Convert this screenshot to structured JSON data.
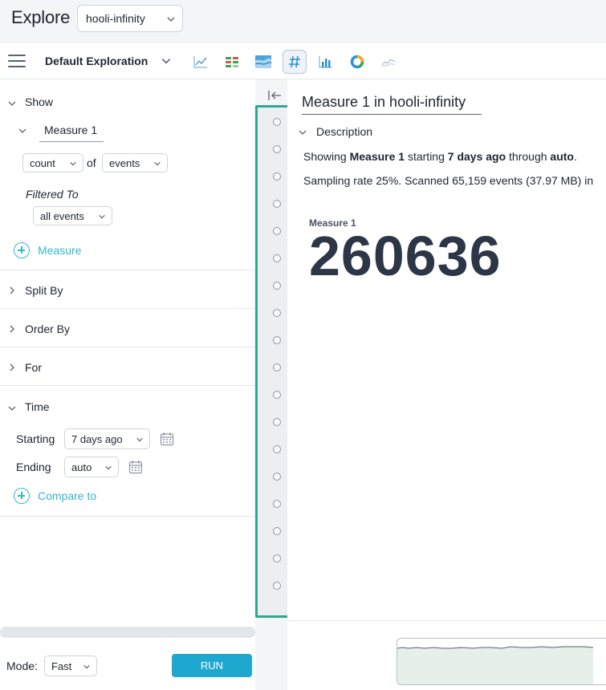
{
  "header": {
    "app_title": "Explore",
    "dataset": "hooli-infinity"
  },
  "toolbar": {
    "exploration_name": "Default Exploration",
    "viz_icons": [
      "line-chart-icon",
      "heatmap-icon",
      "stacked-area-icon",
      "number-icon",
      "bar-chart-icon",
      "donut-icon",
      "sparkline-icon"
    ],
    "active_viz": "number-icon"
  },
  "left_panel": {
    "show": {
      "label": "Show",
      "measure_name": "Measure 1",
      "aggregation": "count",
      "of_label": "of",
      "field": "events",
      "filtered_to_label": "Filtered To",
      "filter_value": "all events",
      "add_measure_label": "Measure"
    },
    "sections": {
      "split_by": "Split By",
      "order_by": "Order By",
      "for": "For",
      "time": "Time"
    },
    "time": {
      "starting_label": "Starting",
      "starting_value": "7 days ago",
      "ending_label": "Ending",
      "ending_value": "auto",
      "compare_label": "Compare to"
    },
    "footer": {
      "mode_label": "Mode:",
      "mode_value": "Fast",
      "run_label": "RUN"
    }
  },
  "main": {
    "query_title": "Measure 1 in hooli-infinity",
    "description_label": "Description",
    "desc": {
      "showing": "Showing",
      "measure": "Measure 1",
      "starting": "starting",
      "start_value": "7 days ago",
      "through": "through",
      "end_value": "auto",
      "period": "."
    },
    "sampling_text": "Sampling rate 25%. Scanned 65,159 events (37.97 MB) in",
    "result": {
      "label": "Measure 1",
      "value": "260636"
    }
  },
  "colors": {
    "accent": "#35b5d1",
    "run_button": "#1fa8cf",
    "highlight_border": "#2ea98e",
    "number_text": "#2d3647"
  }
}
